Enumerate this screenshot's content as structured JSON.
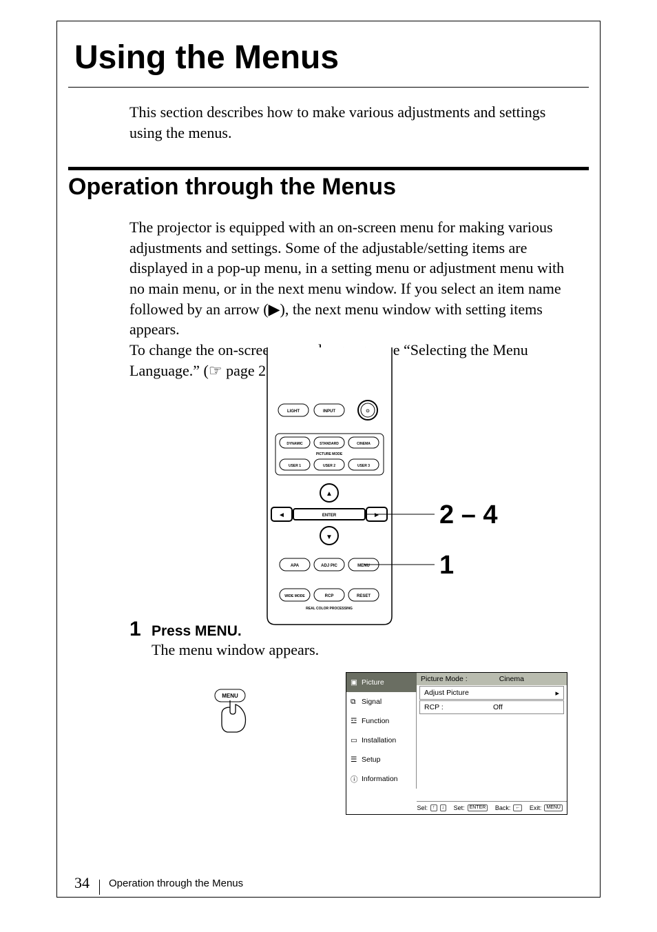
{
  "page": {
    "number": "34",
    "footer_text": "Operation through the Menus"
  },
  "h1": "Using the Menus",
  "intro": "This section describes how to make various adjustments and settings using the menus.",
  "h2": "Operation through the Menus",
  "body1_p1": "The projector is equipped with an on-screen menu for making various adjustments and settings. Some of the adjustable/setting items are displayed in a pop-up menu, in a setting menu or adjustment menu with no main menu, or in the next menu window.  If you select an item name followed by an arrow (▶), the next menu window with setting items appears.",
  "body1_p2_a": "To change the  on-screen menu language, see “Selecting the Menu Language.” (",
  "body1_p2_b": " page 21)",
  "remote": {
    "row1": [
      "LIGHT",
      "INPUT"
    ],
    "mode_label": "PICTURE MODE",
    "modes": [
      "DYNAMIC",
      "STANDARD",
      "CINEMA"
    ],
    "users": [
      "USER 1",
      "USER 2",
      "USER 3"
    ],
    "enter": "ENTER",
    "row_a": [
      "APA",
      "ADJ PIC",
      "MENU"
    ],
    "row_b": [
      "WIDE MODE",
      "RCP",
      "RESET"
    ],
    "rcp_label": "REAL COLOR PROCESSING"
  },
  "callouts": {
    "c1": "2 – 4",
    "c2": "1"
  },
  "step1": {
    "num": "1",
    "title": "Press MENU.",
    "body": "The menu window appears.",
    "press_label": "MENU"
  },
  "osd": {
    "left_items": [
      "Picture",
      "Signal",
      "Function",
      "Installation",
      "Setup",
      "Information"
    ],
    "rows": [
      {
        "label": "Picture Mode :",
        "value": "Cinema",
        "selected": true
      },
      {
        "label": "Adjust Picture",
        "value": "",
        "arrow": true
      },
      {
        "label": "RCP :",
        "value": "Off"
      }
    ],
    "footer": {
      "sel": "Sel:",
      "set": "Set:",
      "set_key": "ENTER",
      "back": "Back:",
      "exit": "Exit:",
      "exit_key": "MENU"
    }
  }
}
